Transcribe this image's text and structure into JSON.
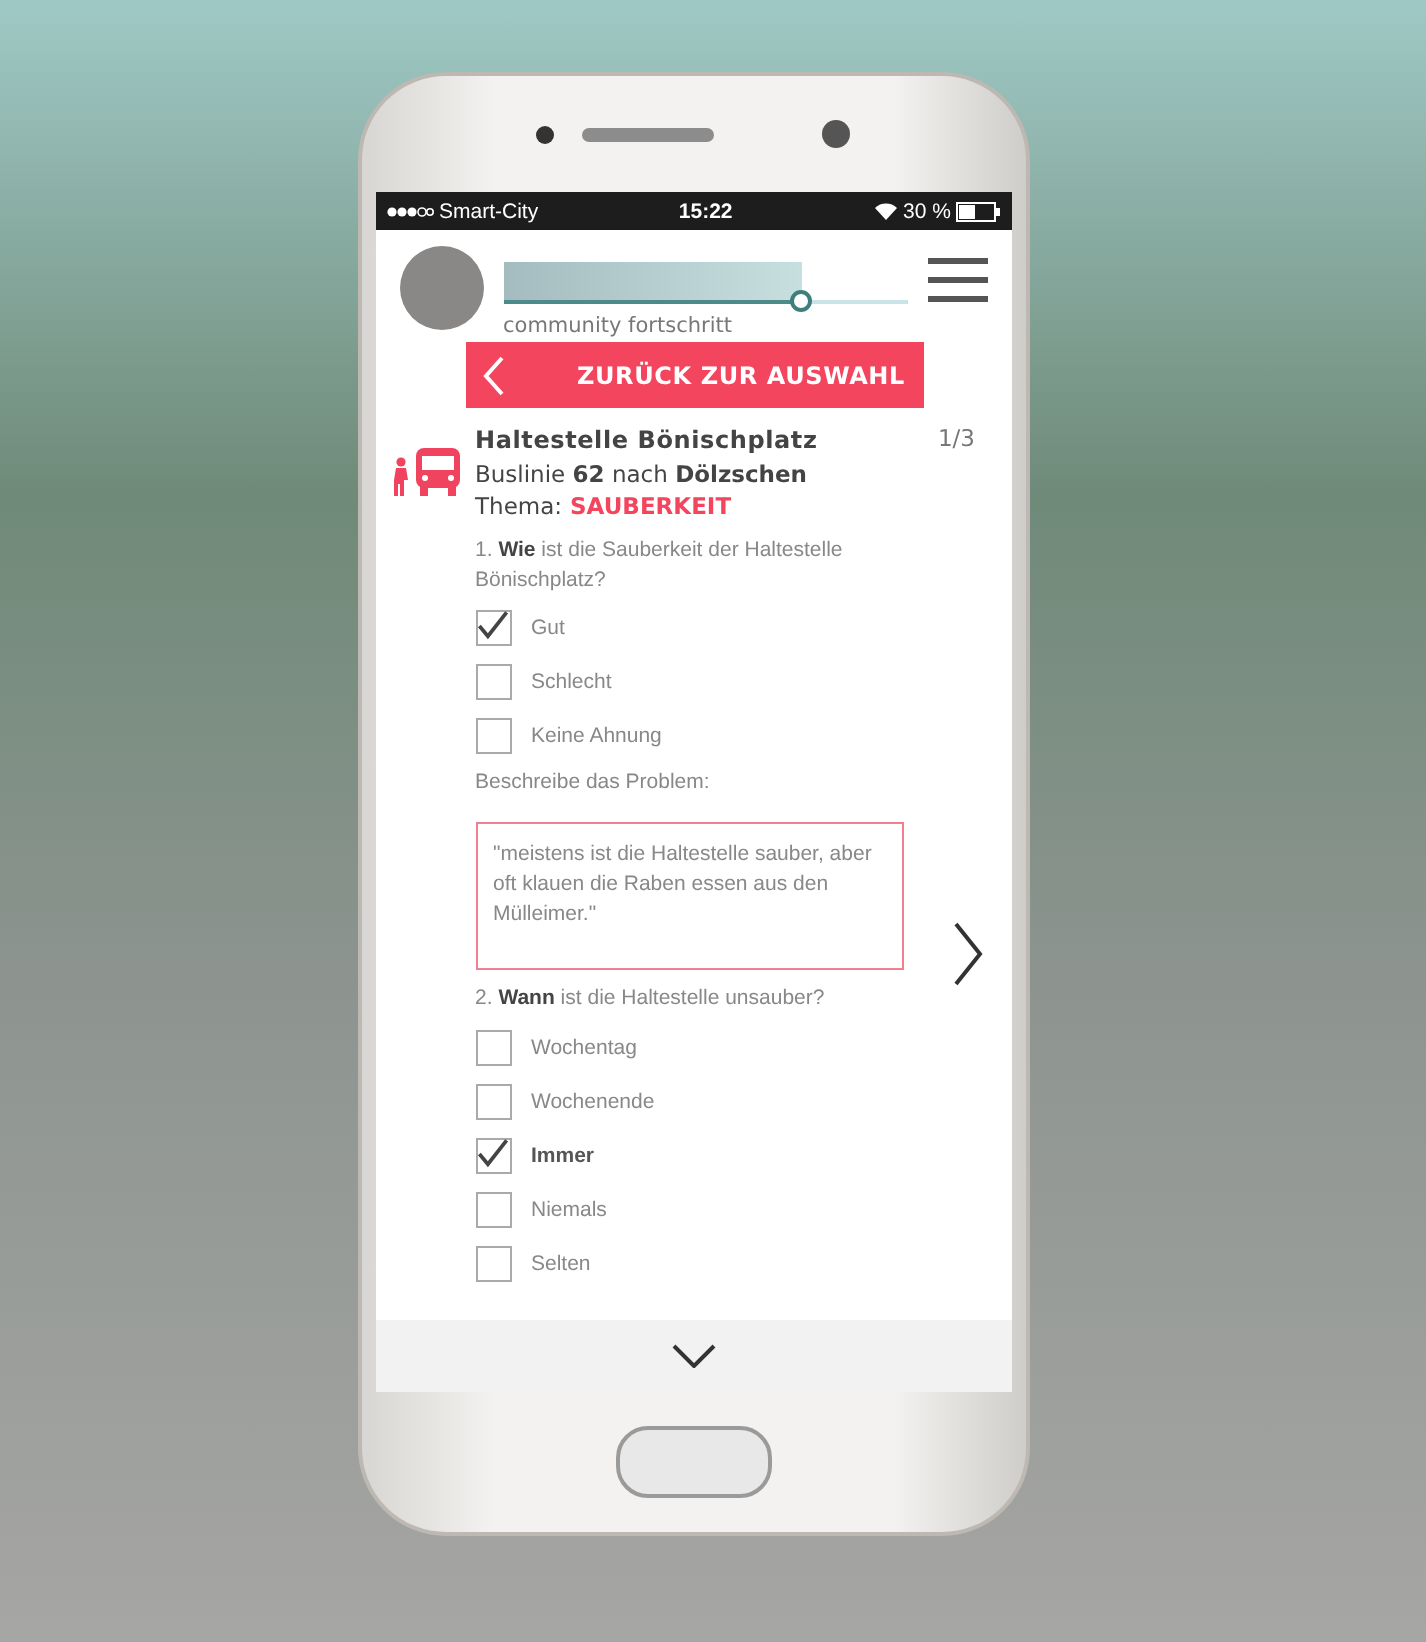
{
  "status_bar": {
    "carrier": "Smart-City",
    "time": "15:22",
    "battery": "30 %"
  },
  "header": {
    "progress": {
      "level": 0.74,
      "label": "community fortschritt"
    },
    "back_button": "ZURÜCK ZUR AUSWAHL"
  },
  "stop": {
    "title": "Haltestelle Bönischplatz",
    "line": "Buslinie **62** nach **Dölzschen**",
    "topic_label": "Thema:",
    "topic": "SAUBERKEIT",
    "counter": "1/3"
  },
  "questions": [
    {
      "text": "1. **Wie** ist die Sauberkeit der Haltestelle Bönischplatz?",
      "options": [
        {
          "label": "Gut",
          "checked": true,
          "emphasized": false
        },
        {
          "label": "Schlecht",
          "checked": false,
          "emphasized": false
        },
        {
          "label": "Keine Ahnung",
          "checked": false,
          "emphasized": false
        }
      ],
      "describe_label": "Beschreibe das Problem:",
      "answer": "\"meistens ist die Haltestelle sauber, aber oft klauen die Raben essen aus den Mülleimer.\""
    },
    {
      "text": "2. **Wann** ist die Haltestelle unsauber?",
      "options": [
        {
          "label": "Wochentag",
          "checked": false,
          "emphasized": false
        },
        {
          "label": "Wochenende",
          "checked": false,
          "emphasized": false
        },
        {
          "label": "Immer",
          "checked": true,
          "emphasized": true
        },
        {
          "label": "Niemals",
          "checked": false,
          "emphasized": false
        },
        {
          "label": "Selten",
          "checked": false,
          "emphasized": false
        }
      ]
    }
  ]
}
